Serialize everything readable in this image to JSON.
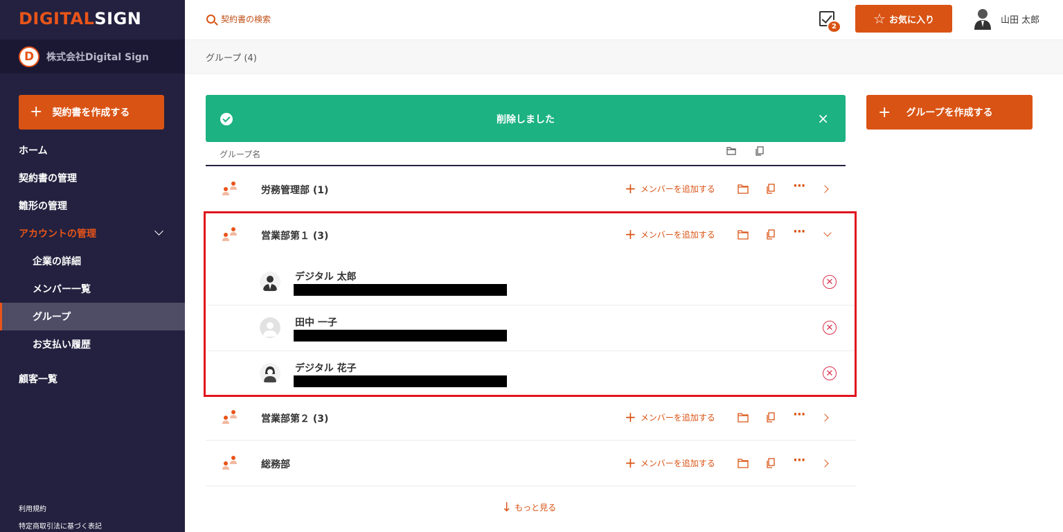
{
  "app": {
    "logo_part1": "DIGITAL",
    "logo_part2": "SIGN",
    "company_initial": "D",
    "company_name": "株式会社Digital Sign"
  },
  "sidebar": {
    "create_button": "契約書を作成する",
    "items": [
      {
        "label": "ホーム"
      },
      {
        "label": "契約書の管理"
      },
      {
        "label": "雛形の管理"
      },
      {
        "label": "アカウントの管理"
      },
      {
        "label": "企業の詳細"
      },
      {
        "label": "メンバー一覧"
      },
      {
        "label": "グループ"
      },
      {
        "label": "お支払い履歴"
      },
      {
        "label": "顧客一覧"
      }
    ],
    "footer": [
      "利用規約",
      "特定商取引法に基づく表記"
    ]
  },
  "header": {
    "search_placeholder": "契約書の検索",
    "notification_count": "2",
    "favorites_label": "お気に入り",
    "user_name": "山田 太郎"
  },
  "breadcrumb": "グループ (4)",
  "toast": {
    "message": "削除しました",
    "close": "×"
  },
  "create_group_button": "グループを作成する",
  "table": {
    "header_label": "グループ名",
    "add_member_label": "メンバーを追加する",
    "groups": [
      {
        "name": "労務管理部 (1)"
      },
      {
        "name": "営業部第１ (3)",
        "expanded": true,
        "members": [
          {
            "name": "デジタル 太郎"
          },
          {
            "name": "田中 一子"
          },
          {
            "name": "デジタル 花子"
          }
        ]
      },
      {
        "name": "営業部第２ (3)"
      },
      {
        "name": "総務部"
      }
    ]
  },
  "more_label": "もっと見る",
  "colors": {
    "accent": "#d95314",
    "sidebar": "#23213f",
    "success": "#1cb281",
    "highlight_border": "#e0141e"
  }
}
